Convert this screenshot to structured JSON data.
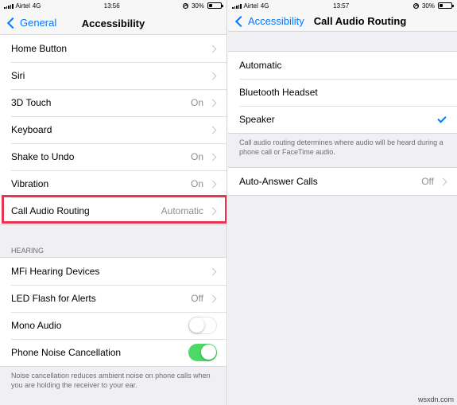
{
  "left": {
    "status": {
      "carrier": "Airtel",
      "network": "4G",
      "time": "13:56",
      "battery": "30%"
    },
    "nav": {
      "back_label": "General",
      "title": "Accessibility"
    },
    "rows": [
      {
        "label": "Home Button",
        "value": ""
      },
      {
        "label": "Siri",
        "value": ""
      },
      {
        "label": "3D Touch",
        "value": "On"
      },
      {
        "label": "Keyboard",
        "value": ""
      },
      {
        "label": "Shake to Undo",
        "value": "On"
      },
      {
        "label": "Vibration",
        "value": "On"
      },
      {
        "label": "Call Audio Routing",
        "value": "Automatic"
      }
    ],
    "hearing": {
      "header": "HEARING",
      "rows": [
        {
          "label": "MFi Hearing Devices",
          "value": ""
        },
        {
          "label": "LED Flash for Alerts",
          "value": "Off"
        },
        {
          "label": "Mono Audio",
          "toggle": false
        },
        {
          "label": "Phone Noise Cancellation",
          "toggle": true
        }
      ],
      "footer": "Noise cancellation reduces ambient noise on phone calls when you are holding the receiver to your ear."
    }
  },
  "right": {
    "status": {
      "carrier": "Airtel",
      "network": "4G",
      "time": "13:57",
      "battery": "30%"
    },
    "nav": {
      "back_label": "Accessibility",
      "title": "Call Audio Routing"
    },
    "options": [
      {
        "label": "Automatic",
        "selected": false
      },
      {
        "label": "Bluetooth Headset",
        "selected": false
      },
      {
        "label": "Speaker",
        "selected": true
      }
    ],
    "options_footer": "Call audio routing determines where audio will be heard during a phone call or FaceTime audio.",
    "auto_answer": {
      "label": "Auto-Answer Calls",
      "value": "Off"
    }
  },
  "watermark": "wsxdn.com",
  "colors": {
    "accent": "#007aff",
    "toggle_on": "#4cd964",
    "highlight": "#e8344e"
  },
  "icons": [
    "signal-icon",
    "lock-rotation-icon",
    "battery-icon",
    "chevron-left-icon",
    "chevron-right-icon",
    "checkmark-icon"
  ]
}
